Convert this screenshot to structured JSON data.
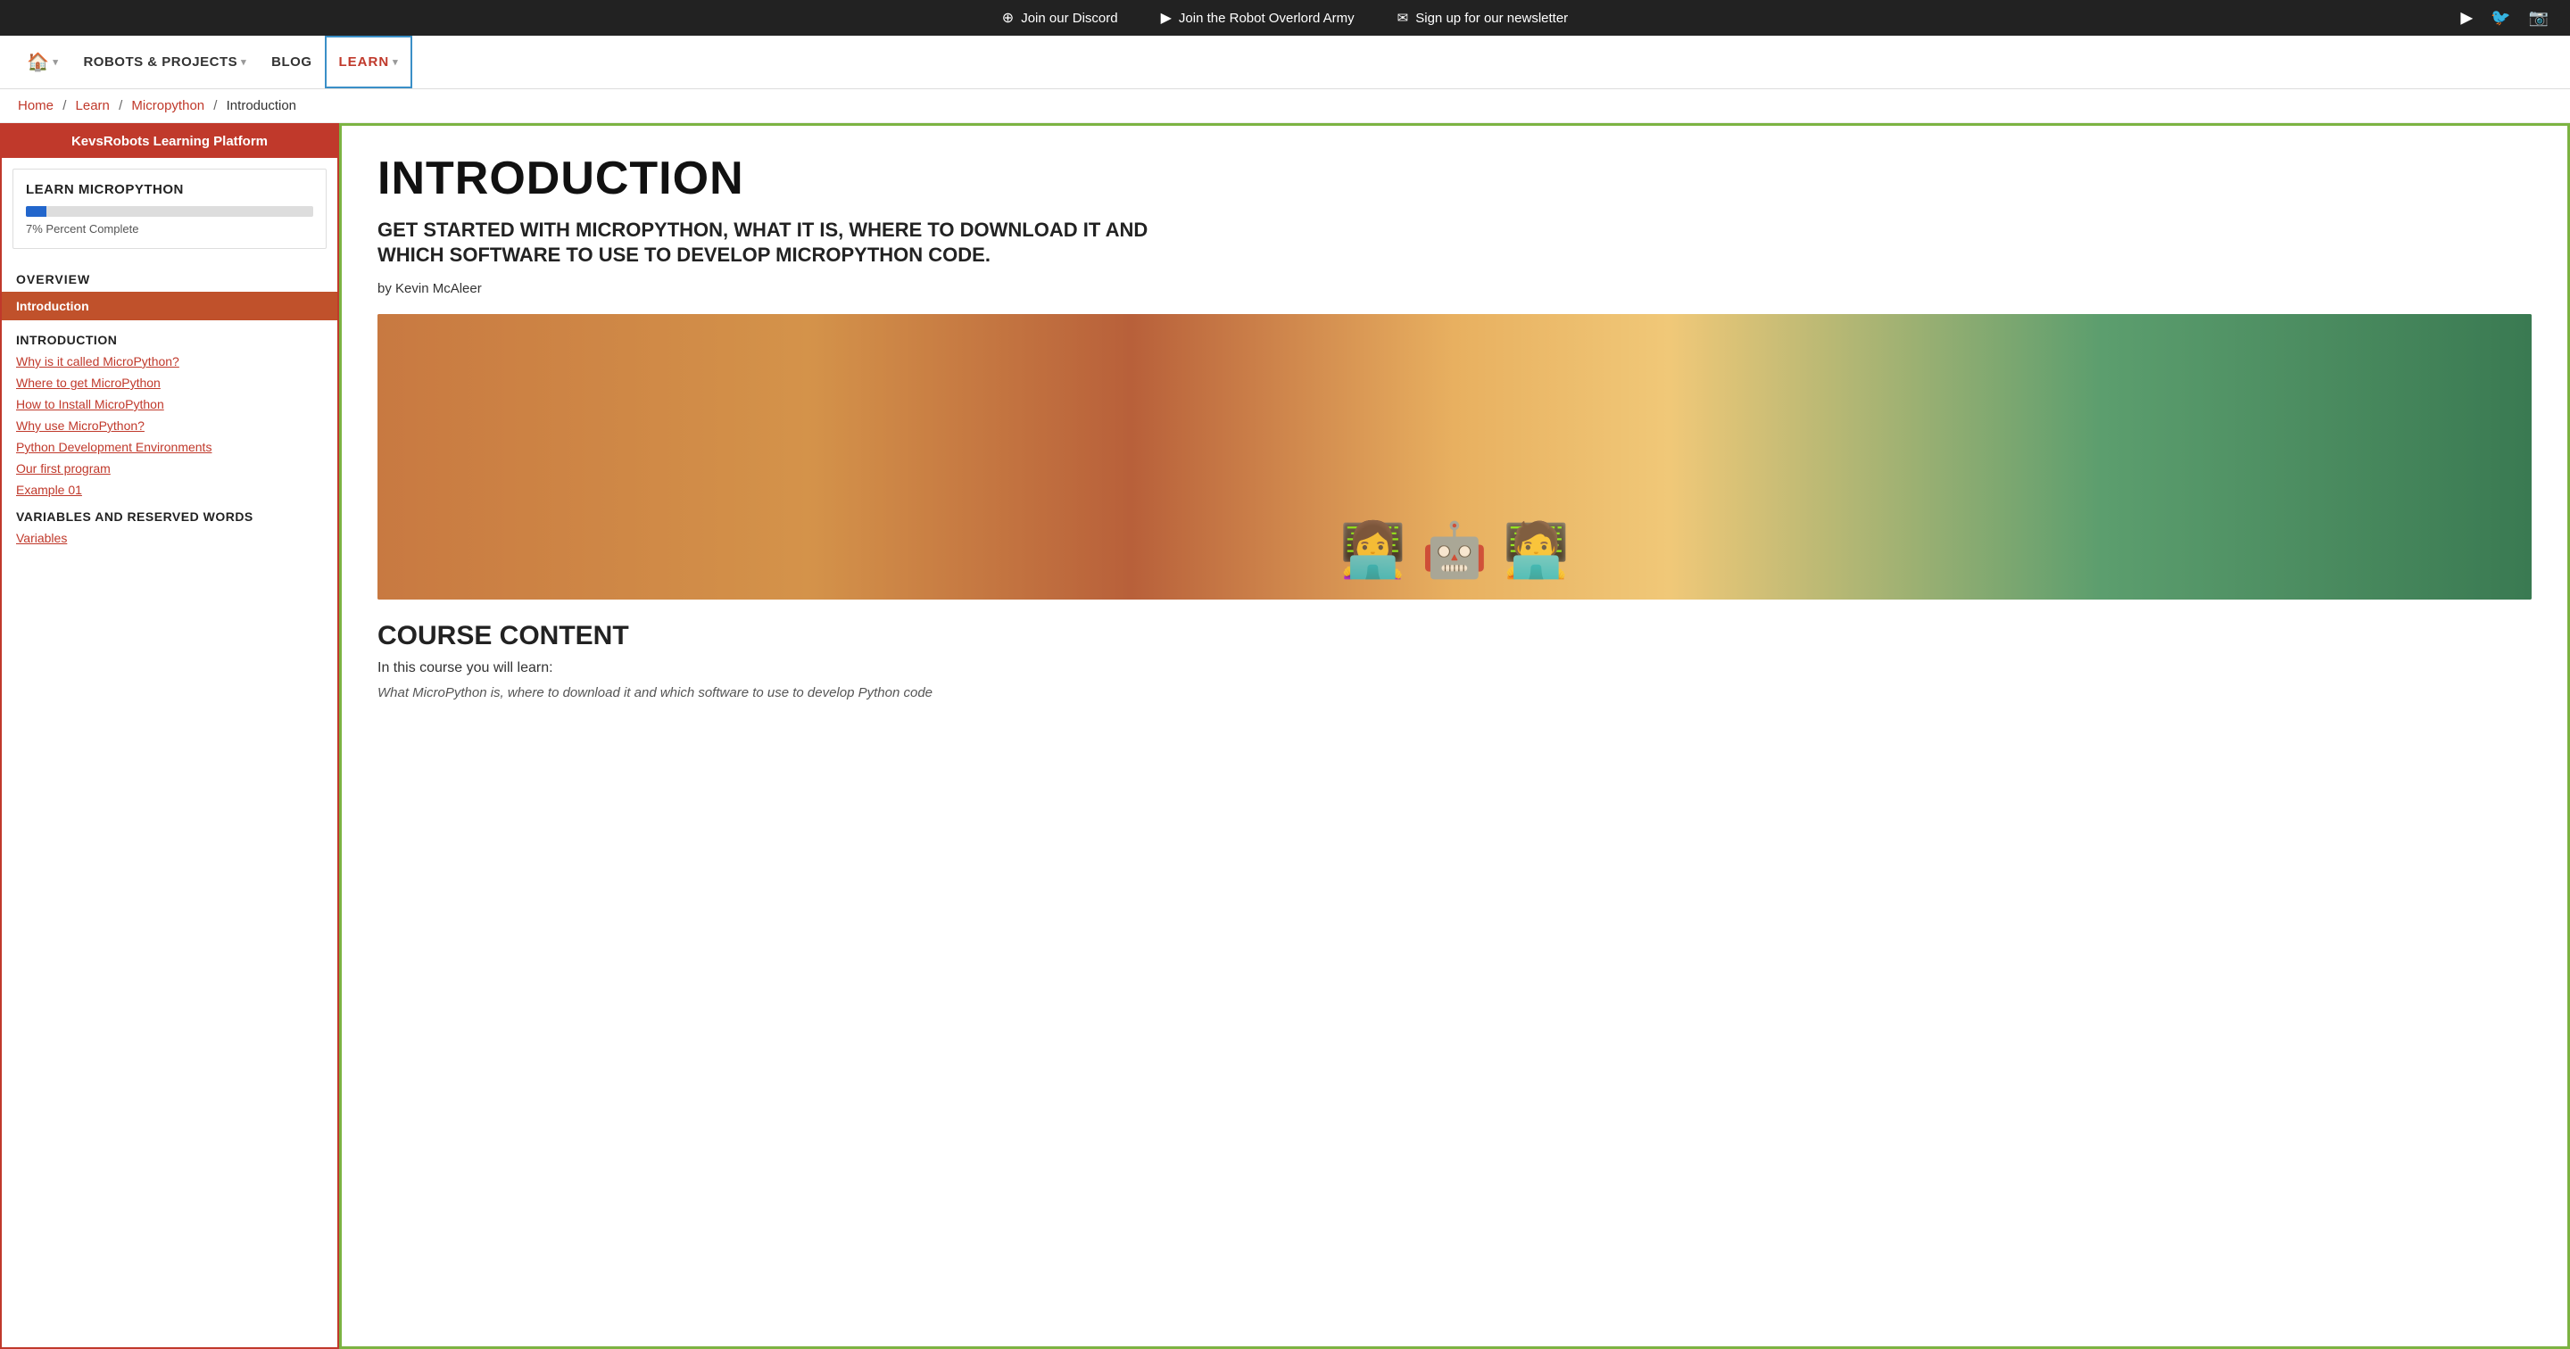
{
  "topbar": {
    "discord_label": "Join our Discord",
    "youtube_label": "Join the Robot Overlord Army",
    "newsletter_label": "Sign up for our newsletter",
    "icons": [
      "youtube",
      "twitter",
      "instagram"
    ]
  },
  "nav": {
    "home_label": "🏠",
    "home_arrow": "▾",
    "robots_label": "ROBOTS & PROJECTS",
    "robots_arrow": "▾",
    "blog_label": "BLOG",
    "learn_label": "LEARN",
    "learn_arrow": "▾"
  },
  "breadcrumb": {
    "home": "Home",
    "learn": "Learn",
    "section": "Micropython",
    "current": "Introduction"
  },
  "sidebar": {
    "platform_header": "KevsRobots Learning Platform",
    "course_title": "LEARN MICROPYTHON",
    "progress_percent": 7,
    "progress_label": "7% Percent Complete",
    "overview_header": "OVERVIEW",
    "active_item": "Introduction",
    "intro_header": "INTRODUCTION",
    "intro_links": [
      "Why is it called MicroPython?",
      "Where to get MicroPython",
      "How to Install MicroPython",
      "Why use MicroPython?",
      "Python Development Environments",
      "Our first program",
      "Example 01"
    ],
    "variables_header": "VARIABLES AND RESERVED WORDS",
    "variables_link": "Variables"
  },
  "content": {
    "title": "INTRODUCTION",
    "subtitle": "GET STARTED WITH MICROPYTHON, WHAT IT IS, WHERE TO DOWNLOAD IT AND WHICH SOFTWARE TO USE TO DEVELOP MICROPYTHON CODE.",
    "author": "by Kevin McAleer",
    "course_content_header": "COURSE CONTENT",
    "course_content_intro": "In this course you will learn:",
    "course_content_item": "What MicroPython is, where to download it and which software to use to develop Python code"
  }
}
